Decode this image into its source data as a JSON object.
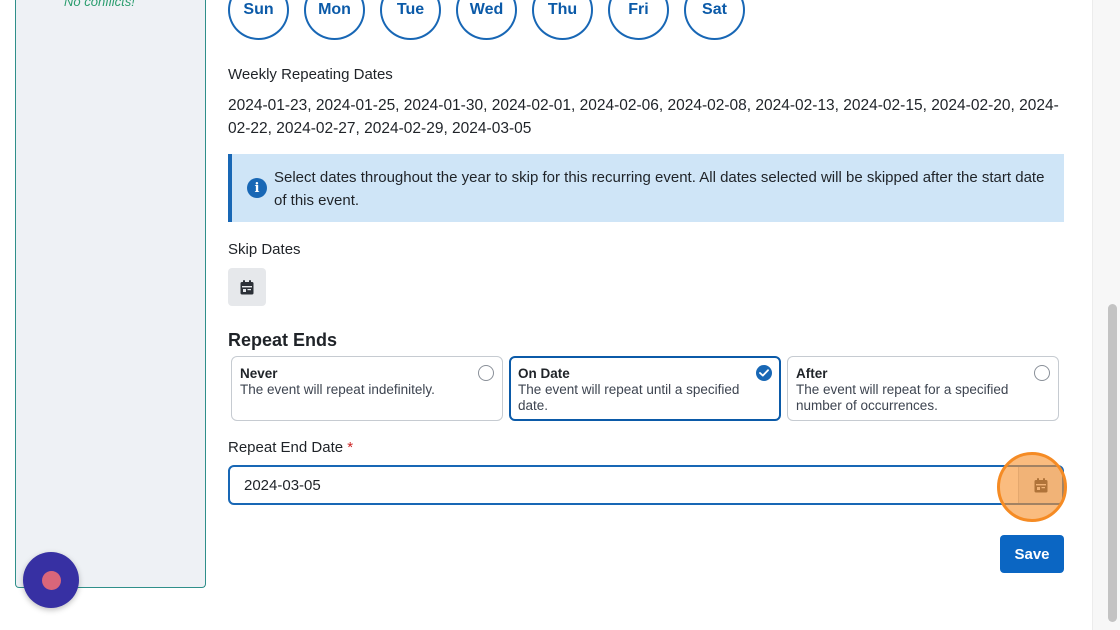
{
  "sidebar": {
    "conflicts_text": "No conflicts!"
  },
  "days": [
    "Sun",
    "Mon",
    "Tue",
    "Wed",
    "Thu",
    "Fri",
    "Sat"
  ],
  "weekly": {
    "label": "Weekly Repeating Dates",
    "dates_text": "2024-01-23, 2024-01-25, 2024-01-30, 2024-02-01, 2024-02-06, 2024-02-08, 2024-02-13, 2024-02-15, 2024-02-20, 2024-02-22, 2024-02-27, 2024-02-29, 2024-03-05"
  },
  "info": {
    "icon": "info-icon",
    "text": "Select dates throughout the year to skip for this recurring event. All dates selected will be skipped after the start date of this event."
  },
  "skip": {
    "label": "Skip Dates",
    "icon": "calendar-icon"
  },
  "repeat_ends": {
    "title": "Repeat Ends",
    "options": [
      {
        "title": "Never",
        "desc": "The event will repeat indefinitely.",
        "selected": false
      },
      {
        "title": "On Date",
        "desc": "The event will repeat until a specified date.",
        "selected": true
      },
      {
        "title": "After",
        "desc": "The event will repeat for a specified number of occurrences.",
        "selected": false
      }
    ]
  },
  "end_date": {
    "label": "Repeat End Date",
    "required_mark": "*",
    "value": "2024-03-05",
    "icon": "calendar-icon"
  },
  "save_label": "Save",
  "colors": {
    "accent": "#1867b5",
    "save": "#0b66c3",
    "highlight": "#f58b24",
    "info_bg": "#cfe5f7",
    "fab": "#3730a3"
  }
}
